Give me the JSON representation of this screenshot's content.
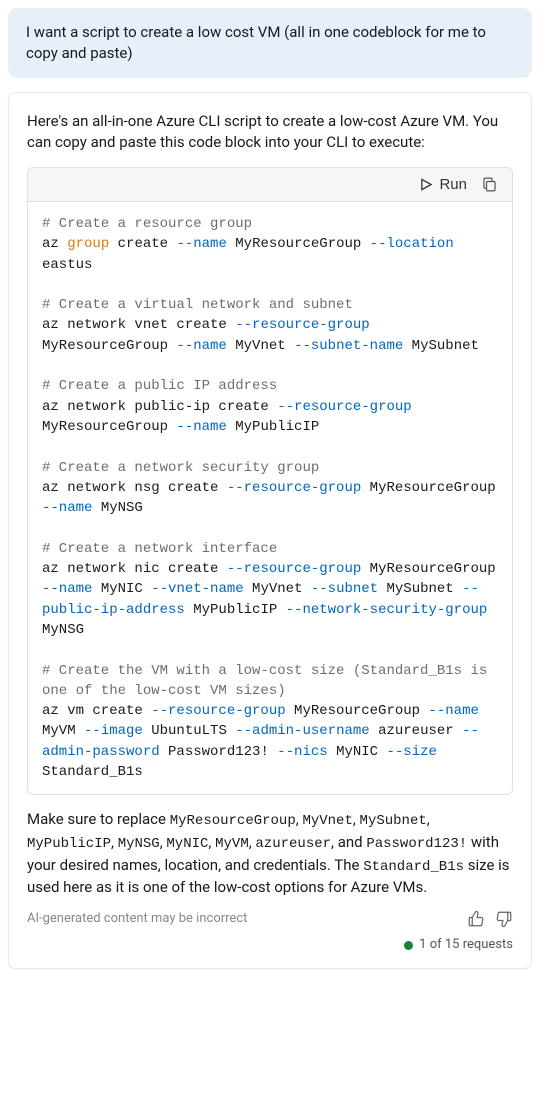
{
  "user": {
    "message": "I want a script to create a low cost VM (all in one codeblock for me to copy and paste)"
  },
  "assistant": {
    "intro": "Here's an all-in-one Azure CLI script to create a low-cost Azure VM. You can copy and paste this code block into your CLI to execute:",
    "toolbar": {
      "run_label": "Run"
    },
    "code": {
      "c1": "# Create a resource group",
      "l1a": "az ",
      "l1kw": "group",
      "l1b": " create ",
      "l1f1": "--name",
      "l1c": " MyResourceGroup ",
      "l1f2": "--location",
      "l1d": " eastus",
      "c2": "# Create a virtual network and subnet",
      "l2a": "az network vnet create ",
      "l2f1": "--resource-group",
      "l2b": " MyResourceGroup ",
      "l2f2": "--name",
      "l2c": " MyVnet ",
      "l2f3": "--subnet-name",
      "l2d": " MySubnet",
      "c3": "# Create a public IP address",
      "l3a": "az network public-ip create ",
      "l3f1": "--resource-group",
      "l3b": " MyResourceGroup ",
      "l3f2": "--name",
      "l3c": " MyPublicIP",
      "c4": "# Create a network security group",
      "l4a": "az network nsg create ",
      "l4f1": "--resource-group",
      "l4b": " MyResourceGroup ",
      "l4f2": "--name",
      "l4c": " MyNSG",
      "c5": "# Create a network interface",
      "l5a": "az network nic create ",
      "l5f1": "--resource-group",
      "l5b": " MyResourceGroup ",
      "l5f2": "--name",
      "l5c": " MyNIC ",
      "l5f3": "--vnet-name",
      "l5d": " MyVnet ",
      "l5f4": "--subnet",
      "l5e": " MySubnet ",
      "l5f5": "--public-ip-address",
      "l5g": " MyPublicIP ",
      "l5f6": "--network-security-group",
      "l5h": " MyNSG",
      "c6": "# Create the VM with a low-cost size (Standard_B1s is one of the low-cost VM sizes)",
      "l6a": "az vm create ",
      "l6f1": "--resource-group",
      "l6b": " MyResourceGroup ",
      "l6f2": "--name",
      "l6c": " MyVM ",
      "l6f3": "--image",
      "l6d": " UbuntuLTS ",
      "l6f4": "--admin-username",
      "l6e": " azureuser ",
      "l6f5": "--admin-password",
      "l6g": " Password123! ",
      "l6f6": "--nics",
      "l6h": " MyNIC ",
      "l6f7": "--size",
      "l6i": " Standard_B1s"
    },
    "outro": {
      "p1": "Make sure to replace ",
      "m1": "MyResourceGroup",
      "s1": ", ",
      "m2": "MyVnet",
      "s2": ", ",
      "m3": "MySubnet",
      "s3": ", ",
      "m4": "MyPublicIP",
      "s4": ", ",
      "m5": "MyNSG",
      "s5": ", ",
      "m6": "MyNIC",
      "s6": ", ",
      "m7": "MyVM",
      "s7": ", ",
      "m8": "azureuser",
      "s8": ", and ",
      "m9": "Password123!",
      "p2": " with your desired names, location, and credentials. The ",
      "m10": "Standard_B1s",
      "p3": " size is used here as it is one of the low-cost options for Azure VMs."
    },
    "disclaimer": "AI-generated content may be incorrect",
    "requests": "1 of 15 requests"
  }
}
